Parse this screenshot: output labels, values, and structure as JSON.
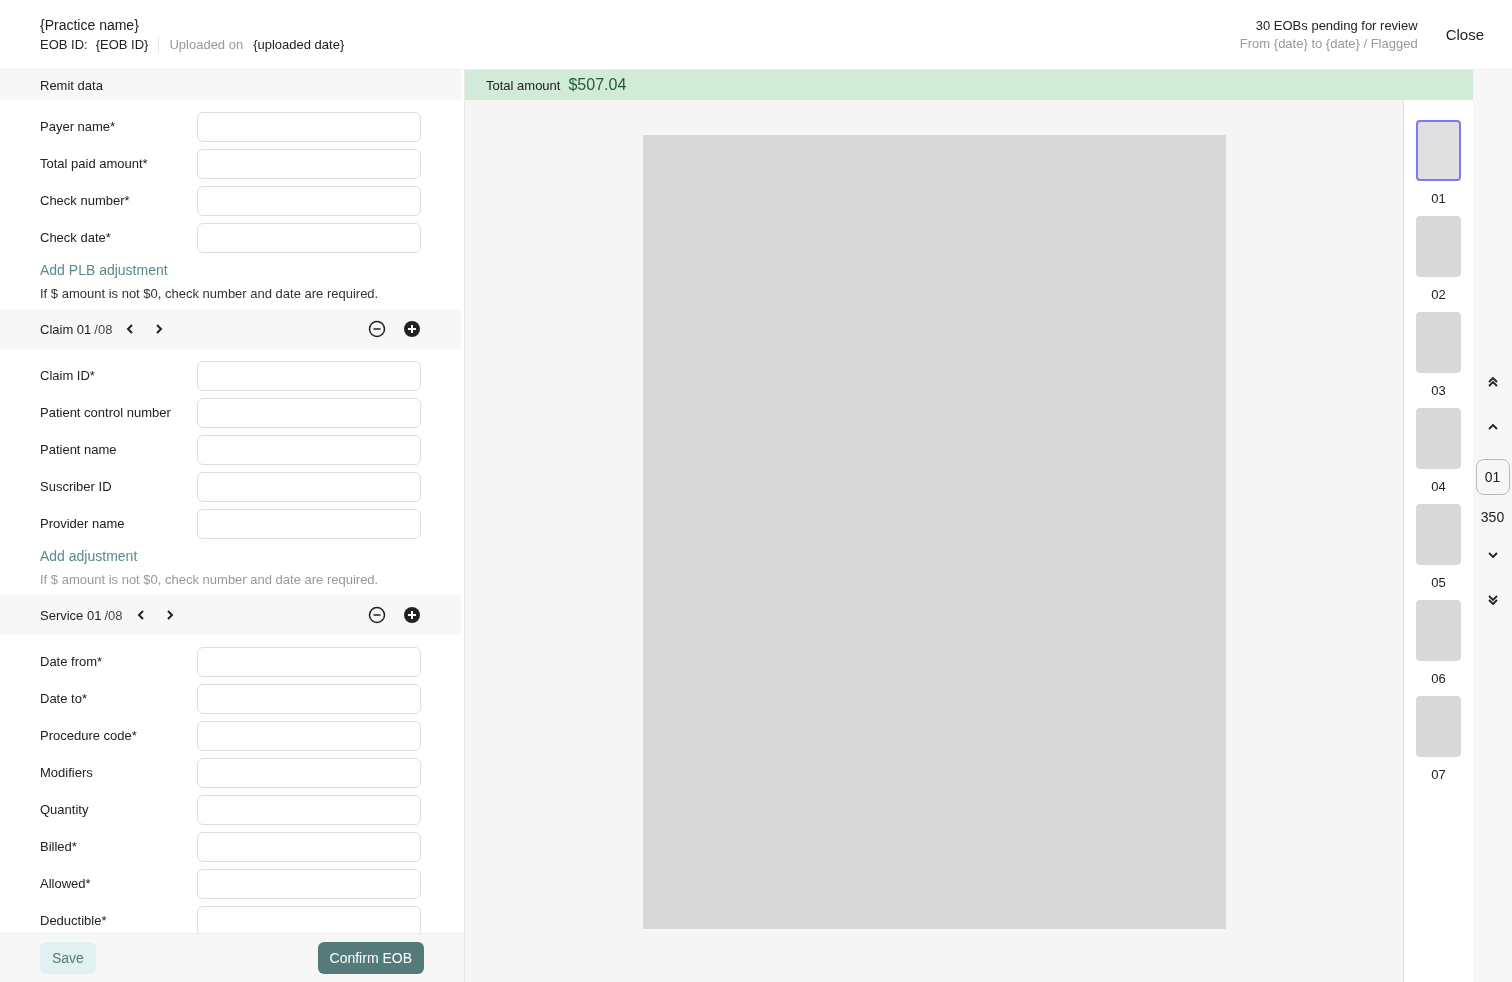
{
  "header": {
    "practice_name": "{Practice name}",
    "eob_id_label": "EOB ID:",
    "eob_id": "{EOB ID}",
    "uploaded_label": "Uploaded on",
    "uploaded_date": "{uploaded date}",
    "pending": "30 EOBs pending for review",
    "range": "From {date} to {date} / Flagged",
    "close": "Close"
  },
  "sections": [
    {
      "kind": "plain",
      "title": "Remit data",
      "fields": [
        "Payer name*",
        "Total paid amount*",
        "Check number*",
        "Check date*"
      ],
      "link": "Add PLB adjustment",
      "note": "If $ amount is not $0, check number and date are required.",
      "note_muted": false
    },
    {
      "kind": "pager",
      "title": "Claim 01",
      "count": "/08",
      "fields": [
        "Claim ID*",
        "Patient control number",
        "Patient name",
        "Suscriber ID",
        "Provider name"
      ],
      "link": "Add adjustment",
      "note": "If $ amount is not $0, check number and date are required.",
      "note_muted": true
    },
    {
      "kind": "pager",
      "title": "Service 01",
      "count": "/08",
      "fields": [
        "Date from*",
        "Date to*",
        "Procedure code*",
        "Modifiers",
        "Quantity",
        "Billed*",
        "Allowed*",
        "Deductible*"
      ]
    }
  ],
  "footer": {
    "save": "Save",
    "confirm": "Confirm EOB"
  },
  "total": {
    "label": "Total amount",
    "value": "$507.04"
  },
  "pages": [
    {
      "label": "01",
      "selected": true
    },
    {
      "label": "02",
      "selected": false
    },
    {
      "label": "03",
      "selected": false
    },
    {
      "label": "04",
      "selected": false
    },
    {
      "label": "05",
      "selected": false
    },
    {
      "label": "06",
      "selected": false
    },
    {
      "label": "07",
      "selected": false
    }
  ],
  "page_nav": {
    "current": "01",
    "total": "350"
  }
}
